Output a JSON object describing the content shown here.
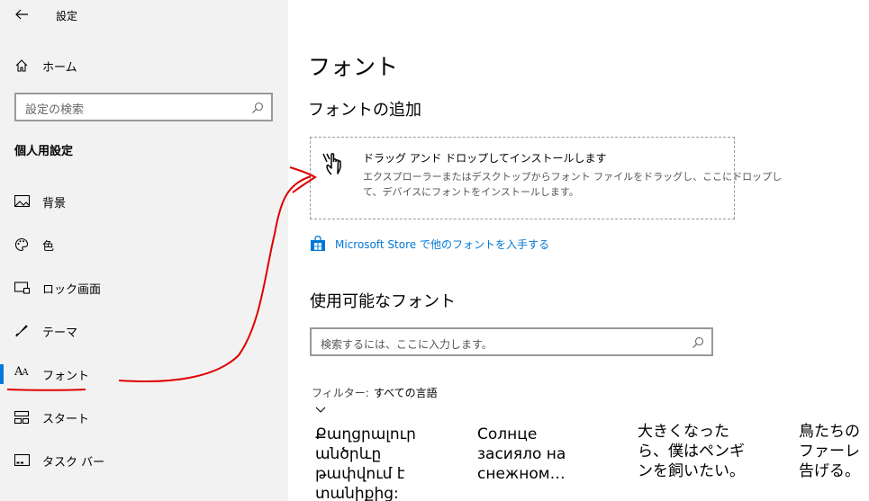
{
  "sidebar": {
    "back_label": "←",
    "title": "設定",
    "home": "ホーム",
    "search_placeholder": "設定の検索",
    "section": "個人用設定",
    "items": [
      {
        "label": "背景",
        "icon": "picture-icon"
      },
      {
        "label": "色",
        "icon": "palette-icon"
      },
      {
        "label": "ロック画面",
        "icon": "lock-screen-icon"
      },
      {
        "label": "テーマ",
        "icon": "theme-icon"
      },
      {
        "label": "フォント",
        "icon": "font-icon",
        "selected": true
      },
      {
        "label": "スタート",
        "icon": "start-icon"
      },
      {
        "label": "タスク バー",
        "icon": "taskbar-icon"
      }
    ]
  },
  "main": {
    "title": "フォント",
    "add_heading": "フォントの追加",
    "drop_title": "ドラッグ アンド ドロップしてインストールします",
    "drop_desc_1": "エクスプローラーまたはデスクトップからフォント ファイルをドラッグし、ここにドロップし",
    "drop_desc_2": "て、デバイスにフォントをインストールします。",
    "store_link": "Microsoft Store で他のフォントを入手する",
    "available_heading": "使用可能なフォント",
    "search_placeholder": "検索するには、ここに入力します。",
    "filter_label": "フィルター:",
    "filter_value": "すべての言語",
    "font_samples": [
      "Քաղցրալուր\nանծրևը\nթափվում է\nտանիքից:",
      "Солнце\nзасияло на\nснежном…",
      "大きくなった\nら、僕はペンギ\nンを飼いたい。",
      "鳥たちの\nファーレ\n告げる。"
    ]
  },
  "colors": {
    "accent": "#0078d7",
    "annotation": "#e00000",
    "sidebar_bg": "#f2f2f2"
  }
}
